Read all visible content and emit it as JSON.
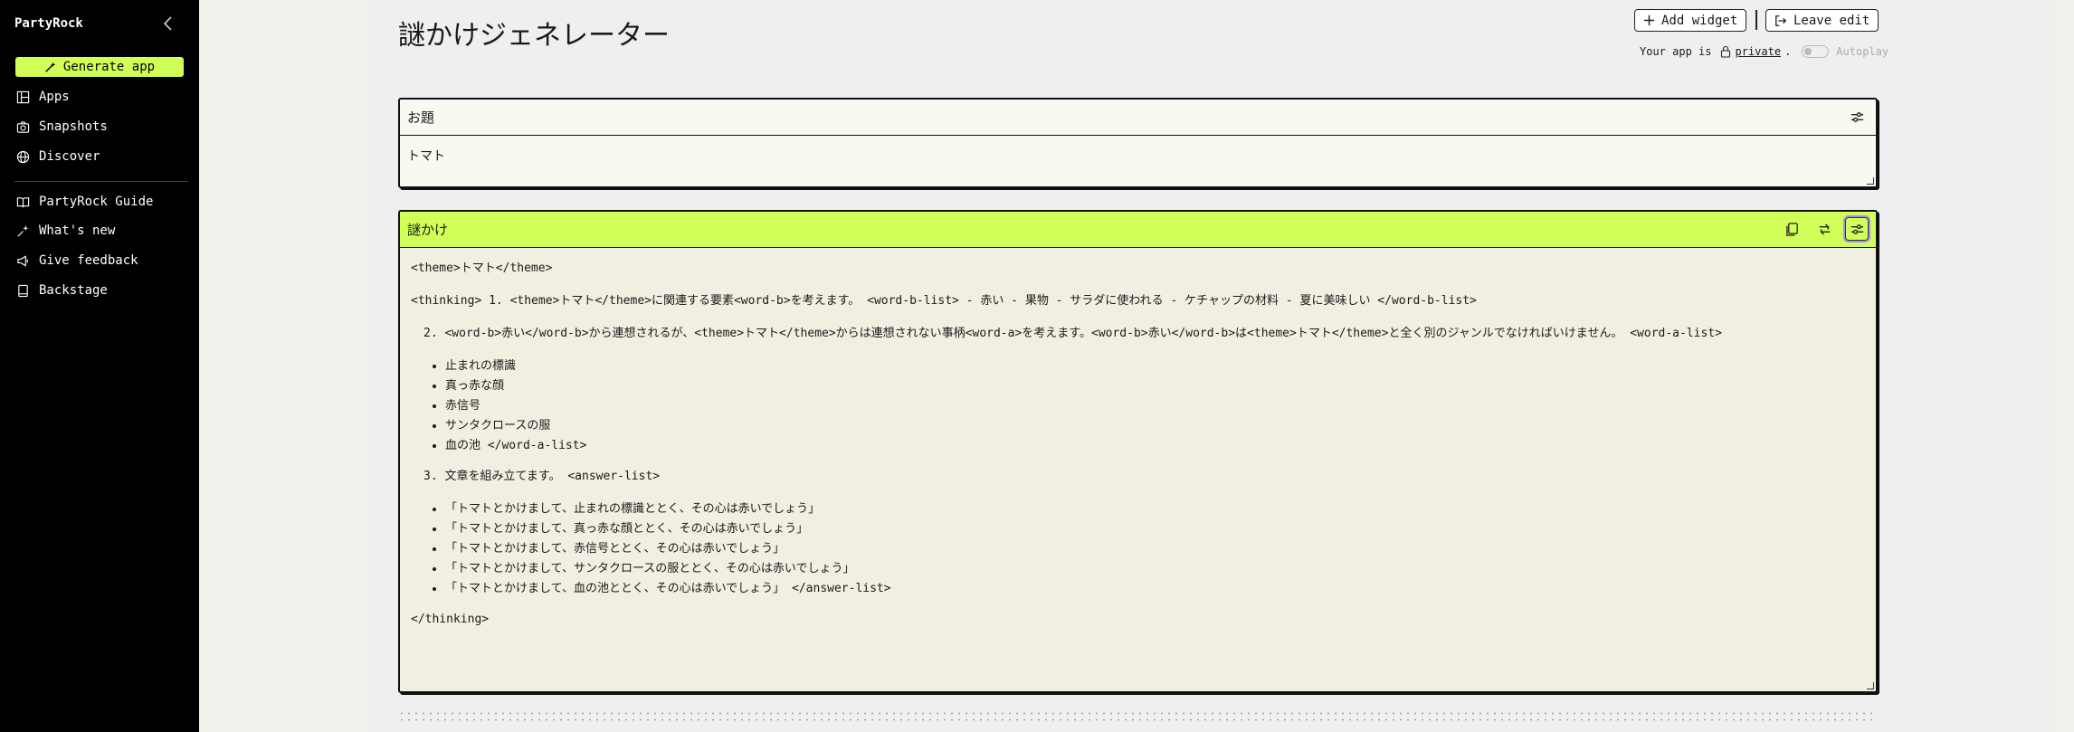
{
  "sidebar": {
    "brand": "PartyRock",
    "generate_label": "Generate app",
    "items": [
      {
        "label": "Apps"
      },
      {
        "label": "Snapshots"
      },
      {
        "label": "Discover"
      },
      {
        "label": "PartyRock Guide"
      },
      {
        "label": "What's new"
      },
      {
        "label": "Give feedback"
      },
      {
        "label": "Backstage"
      }
    ]
  },
  "header": {
    "title": "謎かけジェネレーター",
    "add_widget": "Add widget",
    "leave_edit": "Leave edit",
    "privacy_prefix": "Your app is",
    "privacy_link": "private",
    "privacy_suffix": ".",
    "autoplay": "Autoplay"
  },
  "widget_input": {
    "title": "お題",
    "value": "トマト"
  },
  "widget_output": {
    "title": "謎かけ",
    "line1": "<theme>トマト</theme>",
    "line2": "<thinking> 1. <theme>トマト</theme>に関連する要素<word-b>を考えます。 <word-b-list> - 赤い - 果物 - サラダに使われる - ケチャップの材料 - 夏に美味しい </word-b-list>",
    "line3": "2. <word-b>赤い</word-b>から連想されるが、<theme>トマト</theme>からは連想されない事柄<word-a>を考えます。<word-b>赤い</word-b>は<theme>トマト</theme>と全く別のジャンルでなければいけません。 <word-a-list>",
    "list_a": [
      "止まれの標識",
      "真っ赤な顔",
      "赤信号",
      "サンタクロースの服",
      "血の池 </word-a-list>"
    ],
    "line4": "3. 文章を組み立てます。 <answer-list>",
    "list_b": [
      "「トマトとかけまして、止まれの標識ととく、その心は赤いでしょう」",
      "「トマトとかけまして、真っ赤な顔ととく、その心は赤いでしょう」",
      "「トマトとかけまして、赤信号ととく、その心は赤いでしょう」",
      "「トマトとかけまして、サンタクロースの服ととく、その心は赤いでしょう」",
      "「トマトとかけまして、血の池ととく、その心は赤いでしょう」 </answer-list>"
    ],
    "line5": "</thinking>"
  },
  "colors": {
    "accent": "#d1ff57",
    "sidebar_bg": "#000000",
    "focus_ring": "#a88cff"
  },
  "icons": {
    "collapse": "chevron-left-icon",
    "generate": "magic-wand-icon",
    "apps": "grid-icon",
    "snapshots": "camera-icon",
    "discover": "globe-icon",
    "guide": "book-icon",
    "whats_new": "sparkles-icon",
    "feedback": "megaphone-icon",
    "backstage": "badge-icon",
    "add": "plus-icon",
    "leave": "exit-icon",
    "lock": "lock-icon",
    "settings": "sliders-icon",
    "copy": "copy-icon",
    "rerun": "refresh-icon"
  }
}
